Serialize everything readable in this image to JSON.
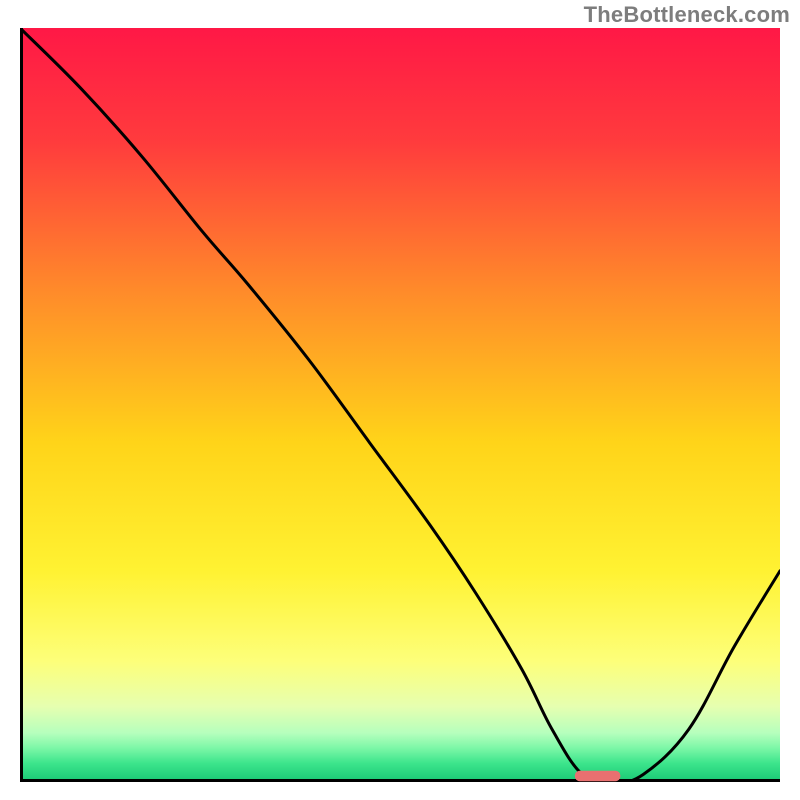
{
  "watermark": "TheBottleneck.com",
  "chart_data": {
    "type": "line",
    "title": "",
    "xlabel": "",
    "ylabel": "",
    "xlim": [
      0,
      100
    ],
    "ylim": [
      0,
      100
    ],
    "grid": false,
    "legend": false,
    "gradient_stops": [
      {
        "offset": 0.0,
        "color": "#ff1846"
      },
      {
        "offset": 0.15,
        "color": "#ff3b3d"
      },
      {
        "offset": 0.35,
        "color": "#ff8b2a"
      },
      {
        "offset": 0.55,
        "color": "#ffd419"
      },
      {
        "offset": 0.72,
        "color": "#fff232"
      },
      {
        "offset": 0.84,
        "color": "#fdff7a"
      },
      {
        "offset": 0.9,
        "color": "#e6ffb0"
      },
      {
        "offset": 0.935,
        "color": "#b6ffbd"
      },
      {
        "offset": 0.955,
        "color": "#7cf7a7"
      },
      {
        "offset": 0.975,
        "color": "#3de58c"
      },
      {
        "offset": 1.0,
        "color": "#18c774"
      }
    ],
    "curve": {
      "description": "black valley curve; high at left, dips to near-zero around x≈75, rises to ~28 at right",
      "x": [
        0,
        8,
        16,
        24,
        30,
        38,
        46,
        54,
        60,
        66,
        70,
        74,
        78,
        82,
        88,
        94,
        100
      ],
      "y": [
        100,
        92,
        83,
        73,
        66,
        56,
        45,
        34,
        25,
        15,
        7,
        1,
        0,
        1,
        7,
        18,
        28
      ]
    },
    "marker": {
      "description": "salmon rounded pill at valley floor",
      "x_center": 76,
      "y_center": 0.8,
      "width": 6,
      "height": 1.4,
      "color": "#e97070"
    },
    "axes_color": "#000000"
  }
}
